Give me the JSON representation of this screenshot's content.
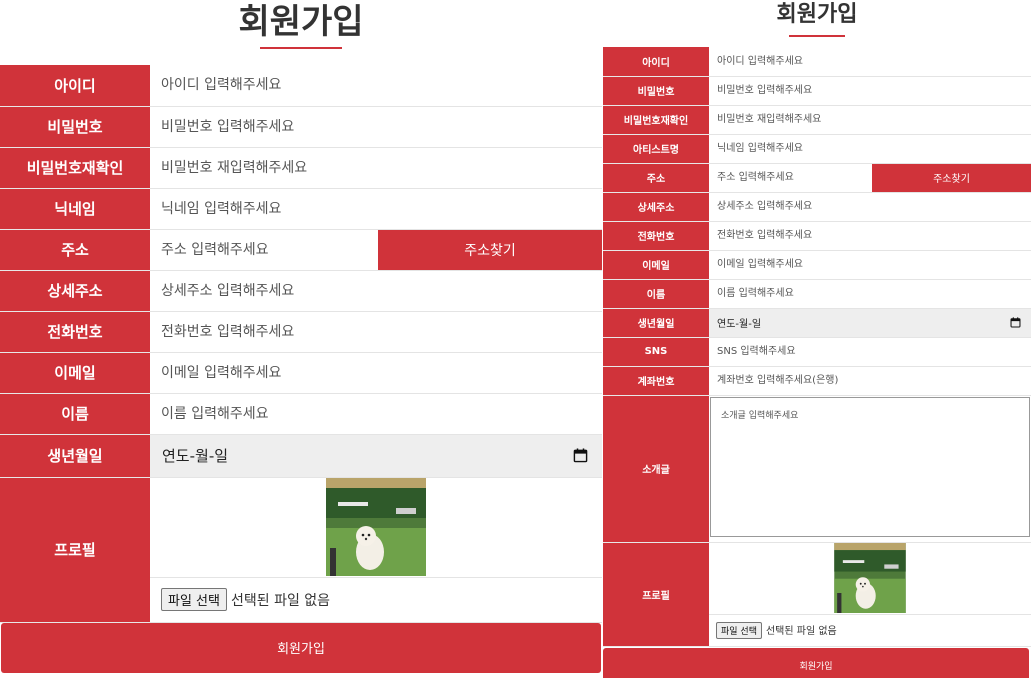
{
  "title": "회원가입",
  "address_button": "주소찾기",
  "date_placeholder": "연도-월-일",
  "file_button": "파일 선택",
  "file_status": "선택된 파일 없음",
  "submit_label": "회원가입",
  "accent_color": "#d0333a",
  "left_form": {
    "fields": [
      {
        "label": "아이디",
        "placeholder": "아이디 입력해주세요"
      },
      {
        "label": "비밀번호",
        "placeholder": "비밀번호 입력해주세요"
      },
      {
        "label": "비밀번호재확인",
        "placeholder": "비밀번호 재입력해주세요"
      },
      {
        "label": "닉네임",
        "placeholder": "닉네임 입력해주세요"
      },
      {
        "label": "주소",
        "placeholder": "주소 입력해주세요"
      },
      {
        "label": "상세주소",
        "placeholder": "상세주소 입력해주세요"
      },
      {
        "label": "전화번호",
        "placeholder": "전화번호 입력해주세요"
      },
      {
        "label": "이메일",
        "placeholder": "이메일 입력해주세요"
      },
      {
        "label": "이름",
        "placeholder": "이름 입력해주세요"
      },
      {
        "label": "생년월일",
        "placeholder": "연도-월-일"
      },
      {
        "label": "프로필",
        "placeholder": ""
      }
    ]
  },
  "right_form": {
    "fields": [
      {
        "label": "아이디",
        "placeholder": "아이디 입력해주세요"
      },
      {
        "label": "비밀번호",
        "placeholder": "비밀번호 입력해주세요"
      },
      {
        "label": "비밀번호재확인",
        "placeholder": "비밀번호 재입력해주세요"
      },
      {
        "label": "아티스트명",
        "placeholder": "닉네임 입력해주세요"
      },
      {
        "label": "주소",
        "placeholder": "주소 입력해주세요"
      },
      {
        "label": "상세주소",
        "placeholder": "상세주소 입력해주세요"
      },
      {
        "label": "전화번호",
        "placeholder": "전화번호 입력해주세요"
      },
      {
        "label": "이메일",
        "placeholder": "이메일 입력해주세요"
      },
      {
        "label": "이름",
        "placeholder": "이름 입력해주세요"
      },
      {
        "label": "생년월일",
        "placeholder": "연도-월-일"
      },
      {
        "label": "SNS",
        "placeholder": "SNS 입력해주세요"
      },
      {
        "label": "계좌번호",
        "placeholder": "계좌번호 입력해주세요(은행)"
      },
      {
        "label": "소개글",
        "placeholder": "소개글 입력해주세요"
      },
      {
        "label": "프로필",
        "placeholder": ""
      }
    ]
  },
  "icons": {
    "calendar": "calendar-icon",
    "profile_photo": "dog-photo"
  }
}
